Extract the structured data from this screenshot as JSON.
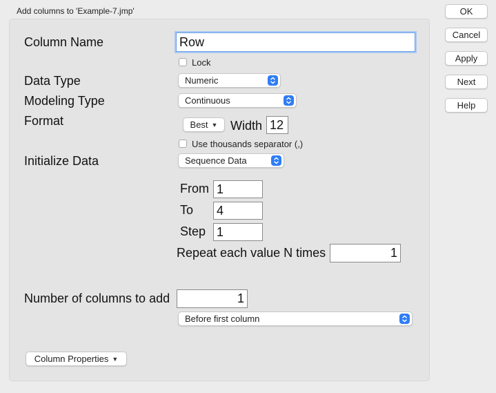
{
  "window": {
    "title": "Add columns to 'Example-7.jmp'"
  },
  "buttons": {
    "ok": "OK",
    "cancel": "Cancel",
    "apply": "Apply",
    "next": "Next",
    "help": "Help"
  },
  "form": {
    "column_name_label": "Column Name",
    "column_name_value": "Row",
    "lock_label": "Lock",
    "data_type_label": "Data Type",
    "data_type_value": "Numeric",
    "modeling_type_label": "Modeling Type",
    "modeling_type_value": "Continuous",
    "format_label": "Format",
    "format_value": "Best",
    "width_label": "Width",
    "width_value": "12",
    "thousands_label": "Use thousands separator (,)",
    "initialize_label": "Initialize Data",
    "initialize_value": "Sequence Data",
    "from_label": "From",
    "from_value": "1",
    "to_label": "To",
    "to_value": "4",
    "step_label": "Step",
    "step_value": "1",
    "repeat_label": "Repeat each value N times",
    "repeat_value": "1",
    "num_columns_label": "Number of columns to add",
    "num_columns_value": "1",
    "position_value": "Before first column",
    "column_properties_label": "Column Properties"
  }
}
